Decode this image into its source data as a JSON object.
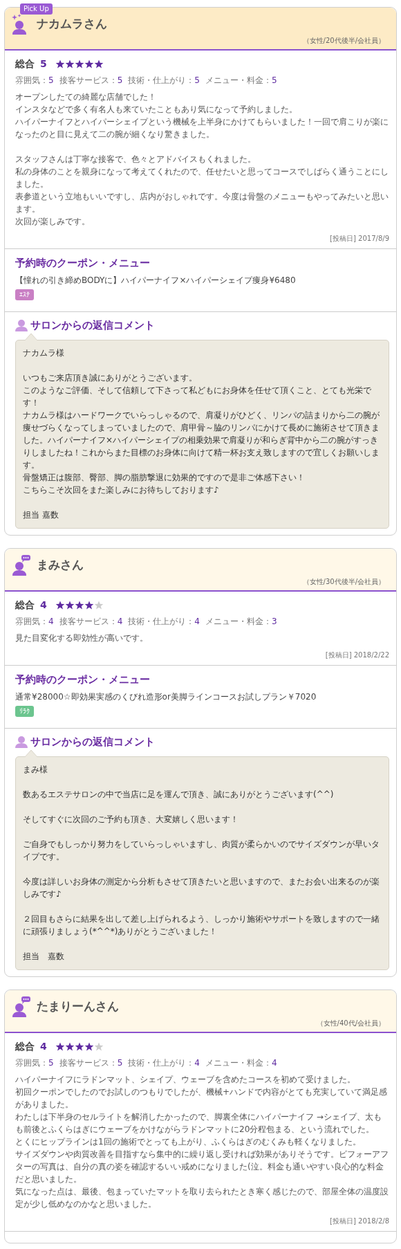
{
  "reviews": [
    {
      "pick_up": true,
      "badge": "Pick Up",
      "name": "ナカムラさん",
      "profile": "（女性/20代後半/会社員）",
      "overall_label": "総合",
      "score": "5",
      "stars": 5,
      "sub_ratings": [
        {
          "label": "雰囲気：",
          "value": "5"
        },
        {
          "label": "接客サービス：",
          "value": "5"
        },
        {
          "label": "技術・仕上がり：",
          "value": "5"
        },
        {
          "label": "メニュー・料金：",
          "value": "5"
        }
      ],
      "body": [
        [
          "オープンしたての綺麗な店舗でした！",
          "インスタなどで多く有名人も来ていたこともあり気になって予約しました。",
          "ハイパーナイフとハイパーシェイプという機械を上半身にかけてもらいました！一回で肩こりが楽になったのと目に見えて二の腕が細くなり驚きました。"
        ],
        [
          "スタッフさんは丁寧な接客で、色々とアドバイスもくれました。",
          "私の身体のことを親身になって考えてくれたので、任せたいと思ってコースでしばらく通うことにしました。",
          "表参道という立地もいいですし、店内がおしゃれです。今度は骨盤のメニューもやってみたいと思います。",
          "次回が楽しみです。"
        ]
      ],
      "date": "[投稿日] 2017/8/9",
      "coupon": {
        "title": "予約時のクーポン・メニュー",
        "text": "【憧れの引き締めBODYに】ハイパーナイフ×ハイパーシェイプ痩身¥6480",
        "tag": {
          "label": "ｴｽﾃ",
          "color": "#c97fc4"
        }
      },
      "reply": {
        "title": "サロンからの返信コメント",
        "body": [
          [
            "ナカムラ様"
          ],
          [
            "いつもご来店頂き誠にありがとうございます。",
            "このようなご評価、そして信頼して下さって私どもにお身体を任せて頂くこと、とても光栄です！",
            "ナカムラ様はハードワークでいらっしゃるので、肩凝りがひどく、リンパの詰まりから二の腕が痩せづらくなってしまっていましたので、肩甲骨～脇のリンパにかけて長めに施術させて頂きました。ハイパーナイフ×ハイパーシェイプの相乗効果で肩凝りが和らぎ背中から二の腕がすっきりしましたね！これからまた目標のお身体に向けて精一杯お支え致しますので宜しくお願いします。",
            "骨盤矯正は腹部、臀部、脚の脂肪撃退に効果的ですので是非ご体感下さい！",
            "こちらこそ次回をまた楽しみにお待ちしております♪"
          ],
          [
            "担当 嘉数"
          ]
        ]
      }
    },
    {
      "pick_up": false,
      "name": "まみさん",
      "profile": "（女性/30代後半/会社員）",
      "overall_label": "総合",
      "score": "4",
      "stars": 4,
      "sub_ratings": [
        {
          "label": "雰囲気：",
          "value": "4"
        },
        {
          "label": "接客サービス：",
          "value": "4"
        },
        {
          "label": "技術・仕上がり：",
          "value": "4"
        },
        {
          "label": "メニュー・料金：",
          "value": "3"
        }
      ],
      "body": [
        [
          "見た目変化する即効性が高いです。"
        ]
      ],
      "date": "[投稿日] 2018/2/22",
      "coupon": {
        "title": "予約時のクーポン・メニュー",
        "text": "通常¥28000☆即効果実感のくびれ造形or美脚ラインコースお試しプラン￥7020",
        "tag": {
          "label": "ﾘﾗｸ",
          "color": "#6cc58f"
        }
      },
      "reply": {
        "title": "サロンからの返信コメント",
        "body": [
          [
            "まみ様"
          ],
          [
            "数あるエステサロンの中で当店に足を運んで頂き、誠にありがとうございます(^^)"
          ],
          [
            "そしてすぐに次回のご予約も頂き、大変嬉しく思います！"
          ],
          [
            "ご自身でもしっかり努力をしていらっしゃいますし、肉質が柔らかいのでサイズダウンが早いタイプです。"
          ],
          [
            "今度は詳しいお身体の測定から分析もさせて頂きたいと思いますので、またお会い出来るのが楽しみです♪"
          ],
          [
            "２回目もさらに結果を出して差し上げられるよう、しっかり施術やサポートを致しますので一緒に頑張りましょう(*^^*)ありがとうございました！"
          ],
          [
            "担当　嘉数"
          ]
        ]
      }
    },
    {
      "pick_up": false,
      "name": "たまりーんさん",
      "profile": "（女性/40代/会社員）",
      "overall_label": "総合",
      "score": "4",
      "stars": 4,
      "sub_ratings": [
        {
          "label": "雰囲気：",
          "value": "5"
        },
        {
          "label": "接客サービス：",
          "value": "5"
        },
        {
          "label": "技術・仕上がり：",
          "value": "4"
        },
        {
          "label": "メニュー・料金：",
          "value": "4"
        }
      ],
      "body": [
        [
          "ハイパーナイフにラドンマット、シェイプ、ウェーブを含めたコースを初めて受けました。",
          "初回クーポンでしたのでお試しのつもりでしたが、機械+ハンドで内容がとても充実していて満足感がありました。",
          "わたしは下半身のセルライトを解消したかったので、脚裏全体にハイパーナイフ →シェイプ、太もも前後とふくらはぎにウェーブをかけながらラドンマットに20分程包まる、という流れでした。",
          "とくにヒップラインは1回の施術でとっても上がり、ふくらはぎのむくみも軽くなりました。",
          "サイズダウンや肉質改善を目指すなら集中的に繰り返し受ければ効果がありそうです。ビフォーアフターの写真は、自分の真の姿を確認するいい戒めになりました(泣。料金も通いやすい良心的な料金だと思いました。",
          "気になった点は、最後、包まっていたマットを取り去られたとき寒く感じたので、部屋全体の温度設定が少し低めなのかなと思いました。"
        ]
      ],
      "date": "[投稿日] 2018/2/8"
    }
  ]
}
